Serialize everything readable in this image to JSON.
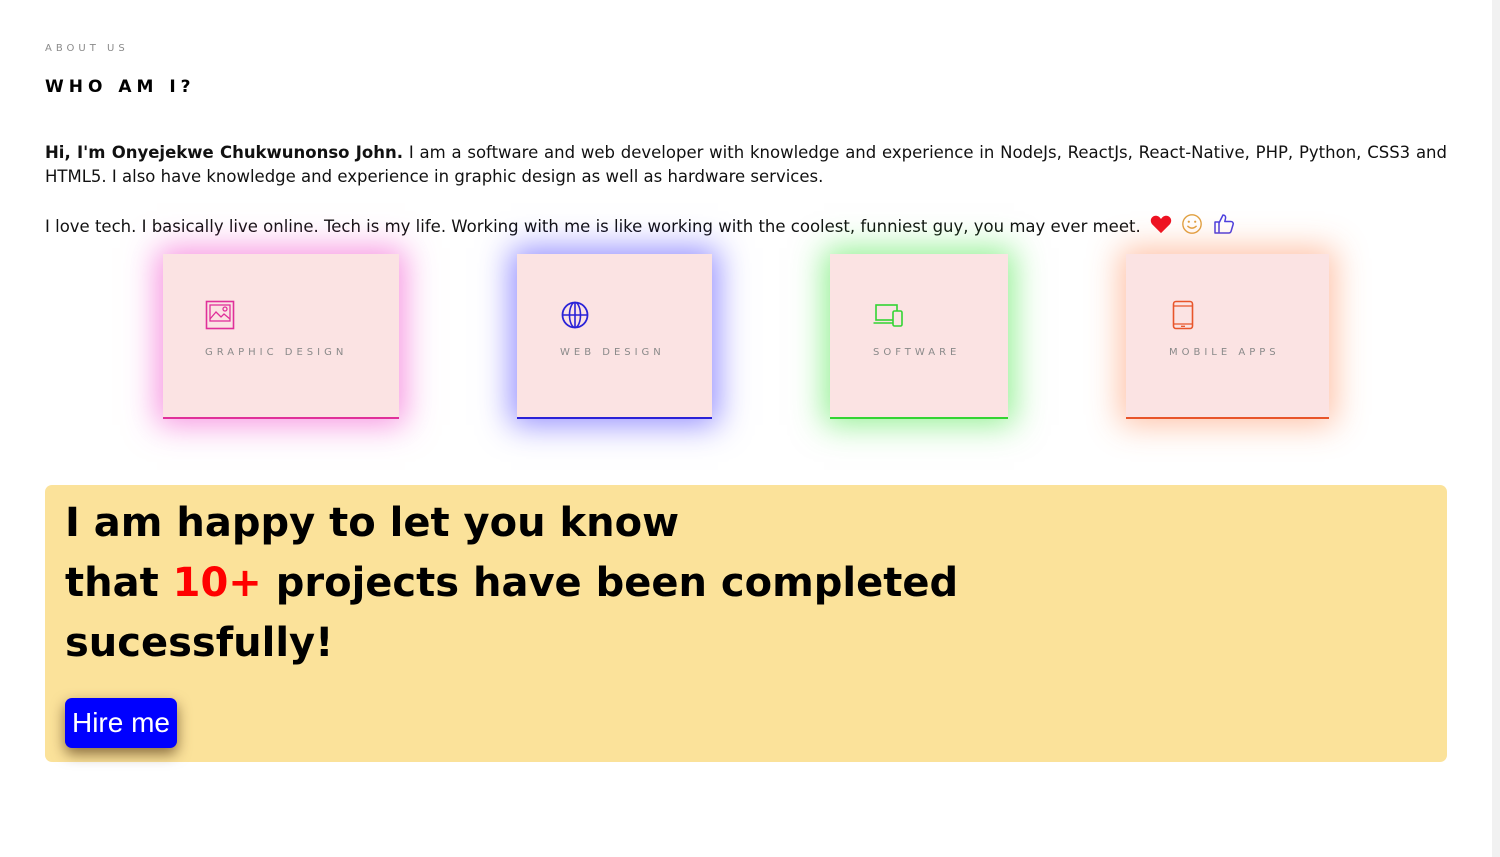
{
  "about": {
    "eyebrow": "ABOUT US",
    "title": "WHO AM I?",
    "intro_name": "Hi, I'm Onyejekwe Chukwunonso John.",
    "intro_text": " I am a software and web developer with knowledge and experience in NodeJs, ReactJs, React-Native, PHP, Python, CSS3 and HTML5. I also have knowledge and experience in graphic design as well as hardware services.",
    "love_text": "I love tech. I basically live online. Tech is my life. Working with me is like working with the coolest, funniest guy, you may ever meet.",
    "emojis": [
      "heart-icon",
      "smile-icon",
      "thumbs-up-icon"
    ]
  },
  "services": [
    {
      "label": "GRAPHIC DESIGN",
      "icon": "image-icon",
      "color": "#e0309a"
    },
    {
      "label": "WEB DESIGN",
      "icon": "globe-icon",
      "color": "#2a22d8"
    },
    {
      "label": "SOFTWARE",
      "icon": "devices-icon",
      "color": "#33d433"
    },
    {
      "label": "MOBILE APPS",
      "icon": "tablet-icon",
      "color": "#e8552a"
    }
  ],
  "banner": {
    "line1": "I am happy to let you know",
    "line2_pre": "that ",
    "count": "10+",
    "line2_post": " projects have been completed",
    "line3": "sucessfully!",
    "hire_label": "Hire me",
    "background": "#fbe29a",
    "button_color": "#0000ff"
  }
}
